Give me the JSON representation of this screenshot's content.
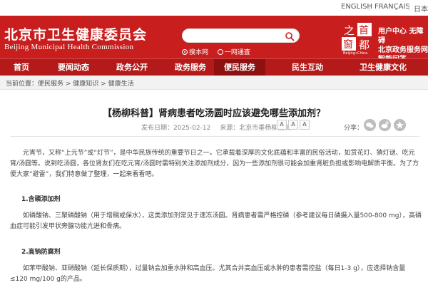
{
  "topbar": {
    "lang_en": "ENGLISH",
    "lang_fr": "FRANÇAIS",
    "lang_jp": "日本"
  },
  "header": {
    "title_cn": "北京市卫生健康委员会",
    "title_en": "Beijing Municipal Health Commission",
    "search_placeholder": "",
    "radio_site": "搜本网",
    "radio_all": "一网通查",
    "logo_chars": [
      "之",
      "首",
      "窗",
      "都"
    ],
    "logo_caption": "Beijing•China",
    "services": [
      "用户中心  无障碍",
      "北京政务服务网",
      "智能问答"
    ]
  },
  "nav": {
    "items": [
      "首页",
      "要闻动态",
      "政务公开",
      "政务服务",
      "便民服务",
      "互动交流",
      "民生互动",
      "卫生健康文化"
    ],
    "active_index": 4
  },
  "breadcrumb": {
    "prefix": "当前位置：",
    "items": [
      "便民服务",
      "健康知识",
      "健康生活"
    ],
    "sep": " > "
  },
  "article": {
    "title": "【杨柳科普】肾病患者吃汤圆时应该避免哪些添加剂？",
    "date": "发布日期：2025-02-12",
    "source": "来源：北京市垂杨柳医院",
    "font_buttons": [
      "A",
      "A",
      "A"
    ],
    "share_label": "分享：",
    "intro": "元宵节，又称“上元节”或“灯节”，是中华民族传统的重要节日之一。它承载着深厚的文化底蕴和丰富的民俗活动，如赏花灯、猜灯谜、吃元宵/汤圆等。说到吃汤圆，各位肾友们在吃元宵/汤圆时需特别关注添加剂成分，因为一些添加剂很可能会加重肾脏负担或影响电解质平衡。为了方便大家“避雷”，我们特意做了整理，一起来看看吧。",
    "h1": "1.含磷添加剂",
    "p1": "如磷酸钠、三聚磷酸钠（用于增稠或保水），这类添加剂常见于速冻汤圆。肾病患者需严格控磷（参考建议每日磷摄入量500-800 mg），高磷血症可能引发甲状旁腺功能亢进和骨病。",
    "h2": "2.高钠防腐剂",
    "p2": "如苯甲酸钠、亚硝酸钠（延长保质期），过量钠会加重水肿和高血压。尤其合并高血压或水肿的患者需控盐（每日1-3 g），应选择钠含量≤120 mg/100 g的产品。"
  },
  "colors": {
    "brand_red": "#c81e1e",
    "nav_red": "#b51a1a",
    "nav_active": "#8e1010"
  }
}
